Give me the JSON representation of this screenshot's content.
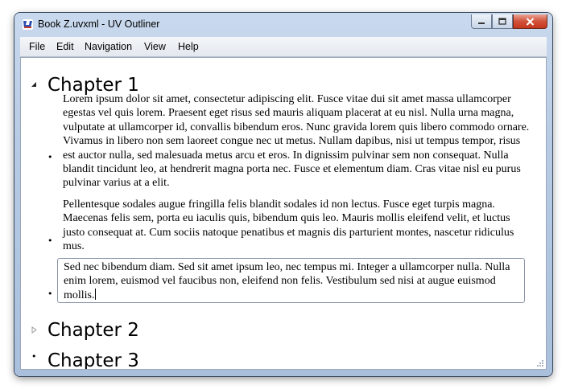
{
  "window": {
    "title": "Book Z.uvxml - UV Outliner",
    "app_icon": "uv-outliner-icon"
  },
  "menu": {
    "items": [
      "File",
      "Edit",
      "Navigation",
      "View",
      "Help"
    ]
  },
  "outline": {
    "chapters": [
      {
        "title": "Chapter 1",
        "expanded": true,
        "paragraphs": [
          "Lorem ipsum dolor sit amet, consectetur adipiscing elit. Fusce vitae dui sit amet massa ullamcorper egestas vel quis lorem. Praesent eget risus sed mauris aliquam placerat at eu nisl. Nulla urna magna, vulputate at ullamcorper id, convallis bibendum eros. Nunc gravida lorem quis libero commodo ornare. Vivamus in libero non sem laoreet congue nec ut metus. Nullam dapibus, nisi ut tempus tempor, risus est auctor nulla, sed malesuada metus arcu et eros. In dignissim pulvinar sem non consequat. Nulla blandit tincidunt leo, at hendrerit magna porta nec. Fusce et elementum diam. Cras vitae nisl eu purus pulvinar varius at a elit.",
          "Pellentesque sodales augue fringilla felis blandit sodales id non lectus. Fusce eget turpis magna. Maecenas felis sem, porta eu iaculis quis, bibendum quis leo. Mauris mollis eleifend velit, et luctus justo consequat at. Cum sociis natoque penatibus et magnis dis parturient montes, nascetur ridiculus mus.",
          "Sed nec bibendum diam. Sed sit amet ipsum leo, nec tempus mi. Integer a ullamcorper nulla. Nulla enim lorem, euismod vel faucibus non, eleifend non felis. Vestibulum sed nisi at augue euismod mollis."
        ]
      },
      {
        "title": "Chapter 2",
        "expanded": false
      },
      {
        "title": "Chapter 3",
        "expanded": false
      }
    ]
  },
  "colors": {
    "title_bar": "#b7cbe4",
    "close_button": "#c4371c",
    "edit_border": "#8a96a8"
  }
}
